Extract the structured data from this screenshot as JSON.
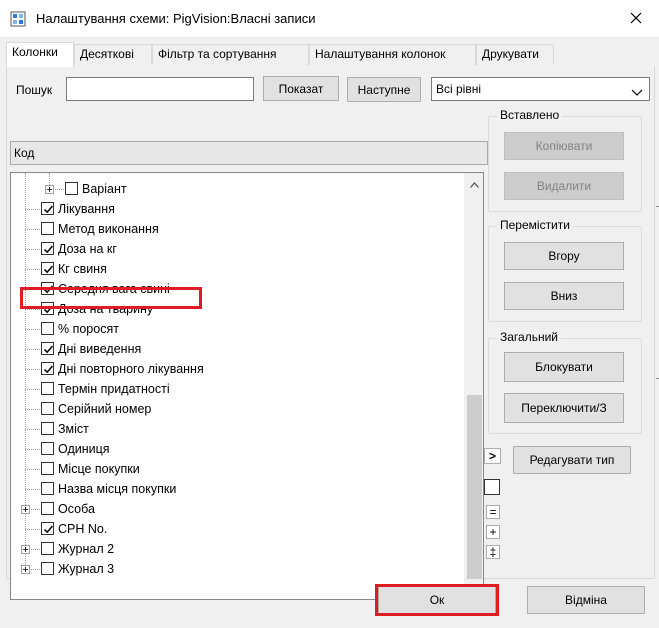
{
  "window": {
    "title": "Налаштування схеми: PigVision:Власні записи",
    "icon": "settings-window-icon",
    "close_icon": "close-icon"
  },
  "tabs": [
    {
      "label": "Колонки",
      "active": true
    },
    {
      "label": "Десяткові",
      "active": false
    },
    {
      "label": "Фільтр та сортування",
      "active": false
    },
    {
      "label": "Налаштування колонок",
      "active": false
    },
    {
      "label": "Друкувати",
      "active": false
    }
  ],
  "search": {
    "label": "Пошук",
    "value": "",
    "show_label": "Показат",
    "next_label": "Наступне",
    "levels_selected": "Всі рівні"
  },
  "tree": {
    "header": "Код",
    "items": [
      {
        "label": "Варіант",
        "checked": false,
        "expandable": true,
        "level": 1
      },
      {
        "label": "Лікування",
        "checked": true,
        "expandable": false,
        "level": 0
      },
      {
        "label": "Метод виконання",
        "checked": false,
        "expandable": false,
        "level": 0
      },
      {
        "label": "Доза на кг",
        "checked": true,
        "expandable": false,
        "level": 0
      },
      {
        "label": "Кг свиня",
        "checked": true,
        "expandable": false,
        "level": 0
      },
      {
        "label": "Середня вага свині",
        "checked": true,
        "expandable": false,
        "level": 0
      },
      {
        "label": "Доза на тварину",
        "checked": true,
        "expandable": false,
        "level": 0
      },
      {
        "label": "% поросят",
        "checked": false,
        "expandable": false,
        "level": 0,
        "highlighted": true
      },
      {
        "label": "Дні виведення",
        "checked": true,
        "expandable": false,
        "level": 0
      },
      {
        "label": "Дні повторного лікування",
        "checked": true,
        "expandable": false,
        "level": 0
      },
      {
        "label": "Термін придатності",
        "checked": false,
        "expandable": false,
        "level": 0
      },
      {
        "label": "Серійний номер",
        "checked": false,
        "expandable": false,
        "level": 0
      },
      {
        "label": "Зміст",
        "checked": false,
        "expandable": false,
        "level": 0
      },
      {
        "label": "Одиниця",
        "checked": false,
        "expandable": false,
        "level": 0
      },
      {
        "label": "Місце покупки",
        "checked": false,
        "expandable": false,
        "level": 0
      },
      {
        "label": "Назва місця покупки",
        "checked": false,
        "expandable": false,
        "level": 0
      },
      {
        "label": "Особа",
        "checked": false,
        "expandable": true,
        "level": 0
      },
      {
        "label": "CPH No.",
        "checked": true,
        "expandable": false,
        "level": 0
      },
      {
        "label": "Журнал 2",
        "checked": false,
        "expandable": true,
        "level": 0
      },
      {
        "label": "Журнал 3",
        "checked": false,
        "expandable": true,
        "level": 0
      }
    ]
  },
  "groups": {
    "inserted": {
      "title": "Вставлено",
      "copy_label": "Копіювати",
      "delete_label": "Видалити"
    },
    "move": {
      "title": "Перемістити",
      "up_label": "Вгору",
      "down_label": "Вниз"
    },
    "general": {
      "title": "Загальний",
      "lock_label": "Блокувати",
      "toggle_label": "Переключити/З"
    }
  },
  "side": {
    "edit_type_label": "Редагувати тип",
    "arrow_glyph": ">",
    "equal_glyph": "=",
    "plus_glyph": "+",
    "dagger_glyph": "‡"
  },
  "footer": {
    "ok_label": "Ок",
    "cancel_label": "Відміна"
  },
  "colors": {
    "highlight": "#e01b24"
  }
}
